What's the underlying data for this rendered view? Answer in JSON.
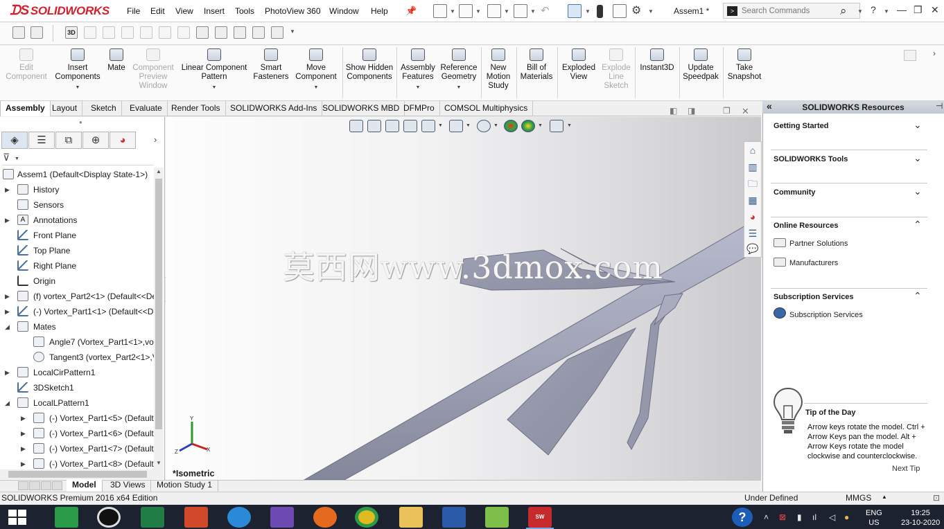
{
  "app": {
    "name": "SOLIDWORKS",
    "document_title": "Assem1 *"
  },
  "menu": [
    "File",
    "Edit",
    "View",
    "Insert",
    "Tools",
    "PhotoView 360",
    "Window",
    "Help"
  ],
  "search": {
    "placeholder": "Search Commands"
  },
  "ribbon": {
    "buttons": [
      {
        "label": "Edit Component",
        "enabled": false
      },
      {
        "label": "Insert Components",
        "enabled": true
      },
      {
        "label": "Mate",
        "enabled": true
      },
      {
        "label": "Component Preview Window",
        "enabled": false
      },
      {
        "label": "Linear Component Pattern",
        "enabled": true
      },
      {
        "label": "Smart Fasteners",
        "enabled": true
      },
      {
        "label": "Move Component",
        "enabled": true
      },
      {
        "label": "Show Hidden Components",
        "enabled": true
      },
      {
        "label": "Assembly Features",
        "enabled": true
      },
      {
        "label": "Reference Geometry",
        "enabled": true
      },
      {
        "label": "New Motion Study",
        "enabled": true
      },
      {
        "label": "Bill of Materials",
        "enabled": true
      },
      {
        "label": "Exploded View",
        "enabled": true
      },
      {
        "label": "Explode Line Sketch",
        "enabled": false
      },
      {
        "label": "Instant3D",
        "enabled": true
      },
      {
        "label": "Update Speedpak",
        "enabled": true
      },
      {
        "label": "Take Snapshot",
        "enabled": true
      }
    ]
  },
  "command_tabs": [
    "Assembly",
    "Layout",
    "Sketch",
    "Evaluate",
    "Render Tools",
    "SOLIDWORKS Add-Ins",
    "SOLIDWORKS MBD",
    "DFMPro",
    "COMSOL Multiphysics"
  ],
  "feature_tree": {
    "root": "Assem1  (Default<Display State-1>)",
    "items": [
      {
        "label": "History",
        "icon": "history-icon"
      },
      {
        "label": "Sensors",
        "icon": "sensors-icon"
      },
      {
        "label": "Annotations",
        "icon": "annotations-icon"
      },
      {
        "label": "Front Plane",
        "icon": "plane-icon"
      },
      {
        "label": "Top Plane",
        "icon": "plane-icon"
      },
      {
        "label": "Right Plane",
        "icon": "plane-icon"
      },
      {
        "label": "Origin",
        "icon": "origin-icon"
      },
      {
        "label": "(f) vortex_Part2<1> (Default<<De",
        "icon": "part-icon"
      },
      {
        "label": "(-) Vortex_Part1<1> (Default<<D",
        "icon": "part-icon"
      },
      {
        "label": "Mates",
        "icon": "mates-icon"
      },
      {
        "label": "Angle7 (Vortex_Part1<1>,vor",
        "icon": "angle-mate-icon"
      },
      {
        "label": "Tangent3 (vortex_Part2<1>,V",
        "icon": "tangent-mate-icon"
      },
      {
        "label": "LocalCirPattern1",
        "icon": "pattern-icon"
      },
      {
        "label": "3DSketch1",
        "icon": "sketch-icon"
      },
      {
        "label": "LocalLPattern1",
        "icon": "pattern-icon"
      },
      {
        "label": "(-) Vortex_Part1<5> (Default",
        "icon": "part-icon"
      },
      {
        "label": "(-) Vortex_Part1<6> (Default",
        "icon": "part-icon"
      },
      {
        "label": "(-) Vortex_Part1<7> (Default",
        "icon": "part-icon"
      },
      {
        "label": "(-) Vortex_Part1<8> (Default",
        "icon": "part-icon"
      }
    ]
  },
  "viewport": {
    "watermark": "莫西网www.3dmox.com",
    "view_label": "*Isometric",
    "triad": {
      "x": "X",
      "y": "Y",
      "z": "Z"
    }
  },
  "resources": {
    "title": "SOLIDWORKS Resources",
    "sections": [
      "Getting Started",
      "SOLIDWORKS Tools",
      "Community",
      "Online Resources",
      "Subscription Services"
    ],
    "online_links": [
      "Partner Solutions",
      "Manufacturers"
    ],
    "subscription_links": [
      "Subscription Services"
    ],
    "tip_title": "Tip of the Day",
    "tip_text": "Arrow keys rotate the model. Ctrl + Arrow Keys pan the model. Alt + Arrow Keys rotate the model clockwise and counterclockwise.",
    "next_tip": "Next Tip"
  },
  "bottom_tabs": [
    "Model",
    "3D Views",
    "Motion Study 1"
  ],
  "status": {
    "edition": "SOLIDWORKS Premium 2016 x64 Edition",
    "state": "Under Defined",
    "units": "MMGS"
  },
  "taskbar": {
    "lang_line1": "ENG",
    "lang_line2": "US",
    "time": "19:25",
    "date": "23-10-2020"
  },
  "colors": {
    "brand_red": "#d4202c",
    "model_gray": "#a2a4b8",
    "taskbar": "#1c2230"
  }
}
